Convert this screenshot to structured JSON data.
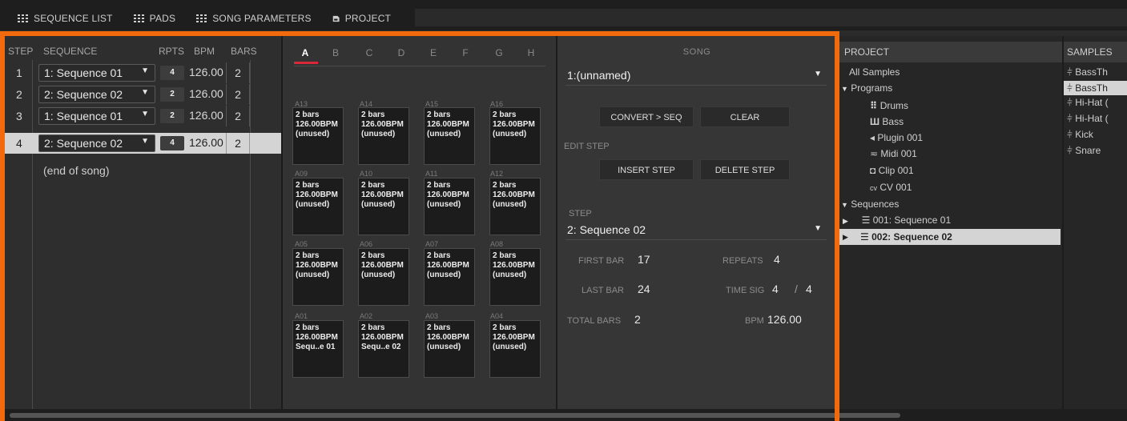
{
  "menu": {
    "items": [
      {
        "label": "SEQUENCE LIST",
        "icon": "grid-icon"
      },
      {
        "label": "PADS",
        "icon": "grid-icon"
      },
      {
        "label": "SONG PARAMETERS",
        "icon": "grid-icon"
      },
      {
        "label": "PROJECT",
        "icon": "document-icon"
      }
    ]
  },
  "sequence_list": {
    "headers": {
      "step": "STEP",
      "sequence": "SEQUENCE",
      "rpts": "RPTS",
      "bpm": "BPM",
      "bars": "BARS"
    },
    "rows": [
      {
        "step": "1",
        "sequence": "1: Sequence 01",
        "rpts": "4",
        "bpm": "126.00",
        "bars": "2"
      },
      {
        "step": "2",
        "sequence": "2: Sequence 02",
        "rpts": "2",
        "bpm": "126.00",
        "bars": "2"
      },
      {
        "step": "3",
        "sequence": "1: Sequence 01",
        "rpts": "2",
        "bpm": "126.00",
        "bars": "2"
      },
      {
        "step": "4",
        "sequence": "2: Sequence 02",
        "rpts": "4",
        "bpm": "126.00",
        "bars": "2"
      }
    ],
    "selected_row": 4,
    "end_label": "(end of song)"
  },
  "pads": {
    "banks": [
      "A",
      "B",
      "C",
      "D",
      "E",
      "F",
      "G",
      "H"
    ],
    "active_bank": "A",
    "rows": [
      [
        {
          "id": "A13",
          "bars": "2 bars",
          "bpm": "126.00BPM",
          "name": "(unused)"
        },
        {
          "id": "A14",
          "bars": "2 bars",
          "bpm": "126.00BPM",
          "name": "(unused)"
        },
        {
          "id": "A15",
          "bars": "2 bars",
          "bpm": "126.00BPM",
          "name": "(unused)"
        },
        {
          "id": "A16",
          "bars": "2 bars",
          "bpm": "126.00BPM",
          "name": "(unused)"
        }
      ],
      [
        {
          "id": "A09",
          "bars": "2 bars",
          "bpm": "126.00BPM",
          "name": "(unused)"
        },
        {
          "id": "A10",
          "bars": "2 bars",
          "bpm": "126.00BPM",
          "name": "(unused)"
        },
        {
          "id": "A11",
          "bars": "2 bars",
          "bpm": "126.00BPM",
          "name": "(unused)"
        },
        {
          "id": "A12",
          "bars": "2 bars",
          "bpm": "126.00BPM",
          "name": "(unused)"
        }
      ],
      [
        {
          "id": "A05",
          "bars": "2 bars",
          "bpm": "126.00BPM",
          "name": "(unused)"
        },
        {
          "id": "A06",
          "bars": "2 bars",
          "bpm": "126.00BPM",
          "name": "(unused)"
        },
        {
          "id": "A07",
          "bars": "2 bars",
          "bpm": "126.00BPM",
          "name": "(unused)"
        },
        {
          "id": "A08",
          "bars": "2 bars",
          "bpm": "126.00BPM",
          "name": "(unused)"
        }
      ],
      [
        {
          "id": "A01",
          "bars": "2 bars",
          "bpm": "126.00BPM",
          "name": "Sequ..e 01"
        },
        {
          "id": "A02",
          "bars": "2 bars",
          "bpm": "126.00BPM",
          "name": "Sequ..e 02"
        },
        {
          "id": "A03",
          "bars": "2 bars",
          "bpm": "126.00BPM",
          "name": "(unused)"
        },
        {
          "id": "A04",
          "bars": "2 bars",
          "bpm": "126.00BPM",
          "name": "(unused)"
        }
      ]
    ]
  },
  "song": {
    "title": "SONG",
    "song_select": "1:(unnamed)",
    "convert_label": "CONVERT > SEQ",
    "clear_label": "CLEAR",
    "edit_step_label": "EDIT STEP",
    "insert_label": "INSERT STEP",
    "delete_label": "DELETE STEP",
    "step_label": "STEP",
    "step_select": "2: Sequence 02",
    "first_bar_label": "FIRST BAR",
    "first_bar": "17",
    "repeats_label": "REPEATS",
    "repeats": "4",
    "last_bar_label": "LAST BAR",
    "last_bar": "24",
    "time_sig_label": "TIME SIG",
    "time_sig_num": "4",
    "time_sig_sep": "/",
    "time_sig_den": "4",
    "total_bars_label": "TOTAL BARS",
    "total_bars": "2",
    "bpm_label": "BPM",
    "bpm": "126.00"
  },
  "project": {
    "title": "PROJECT",
    "all_samples": "All Samples",
    "programs_label": "Programs",
    "programs": [
      {
        "name": "Drums",
        "icon": "drum-grid-icon"
      },
      {
        "name": "Bass",
        "icon": "keyboard-icon"
      },
      {
        "name": "Plugin 001",
        "icon": "plugin-icon"
      },
      {
        "name": "Midi 001",
        "icon": "midi-icon"
      },
      {
        "name": "Clip 001",
        "icon": "clip-icon"
      },
      {
        "name": "CV 001",
        "icon": "cv-icon"
      }
    ],
    "sequences_label": "Sequences",
    "sequences": [
      "001: Sequence 01",
      "002: Sequence 02"
    ],
    "selected_sequence": "002: Sequence 02"
  },
  "samples": {
    "title": "SAMPLES",
    "items": [
      "BassTh",
      "BassTh",
      "Hi-Hat (",
      "Hi-Hat (",
      "Kick",
      "Snare"
    ],
    "selected_index": 1
  },
  "colors": {
    "accent_orange": "#f26a0e",
    "bank_underline": "#d8283a",
    "selection": "#d4d4d4"
  }
}
